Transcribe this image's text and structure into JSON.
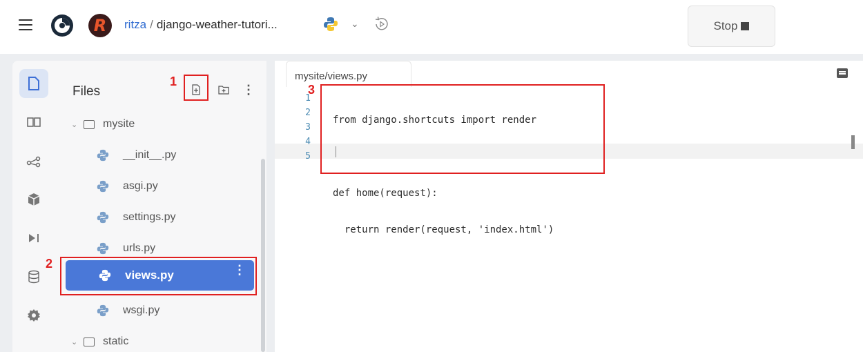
{
  "header": {
    "user": "ritza",
    "separator": "/",
    "repl_name": "django-weather-tutori...",
    "stop_label": "Stop"
  },
  "files_panel": {
    "title": "Files",
    "tree": [
      {
        "type": "folder",
        "label": "mysite",
        "expanded": true
      },
      {
        "type": "file",
        "label": "__init__.py"
      },
      {
        "type": "file",
        "label": "asgi.py"
      },
      {
        "type": "file",
        "label": "settings.py"
      },
      {
        "type": "file",
        "label": "urls.py"
      },
      {
        "type": "file",
        "label": "views.py",
        "selected": true
      },
      {
        "type": "file",
        "label": "wsgi.py"
      },
      {
        "type": "folder",
        "label": "static",
        "expanded": true
      }
    ]
  },
  "editor": {
    "tab_label": "mysite/views.py",
    "line_numbers": [
      "1",
      "2",
      "3",
      "4",
      "5"
    ],
    "lines": [
      "from django.shortcuts import render",
      "",
      "def home(request):",
      "  return render(request, 'index.html')",
      ""
    ]
  },
  "annotations": {
    "n1": "1",
    "n2": "2",
    "n3": "3"
  },
  "colors": {
    "accent": "#4a78d8",
    "annotation": "#e02020",
    "user_link": "#2f6bd1"
  }
}
